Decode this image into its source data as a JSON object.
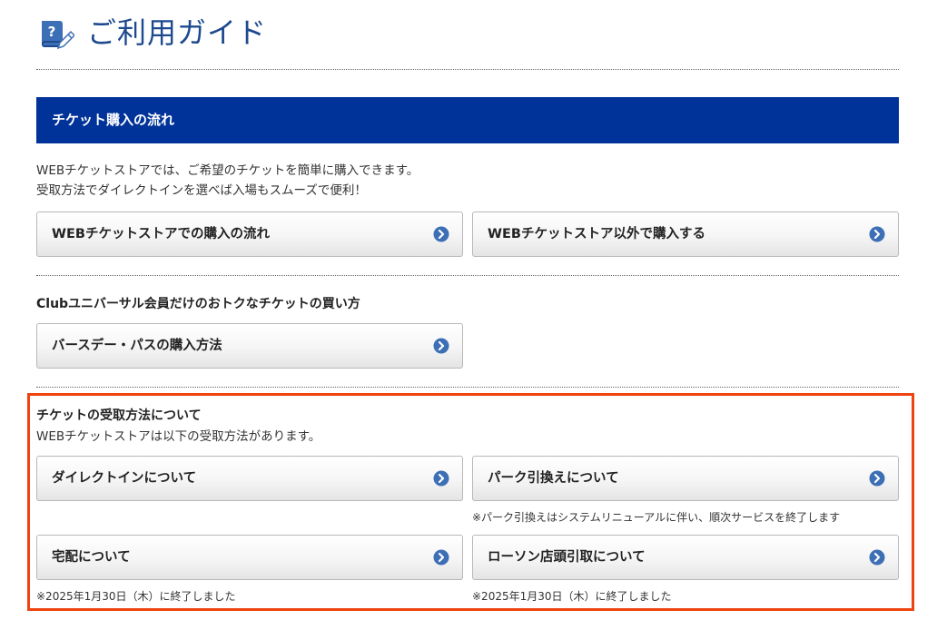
{
  "header": {
    "title": "ご利用ガイド",
    "icon": "guide-question-icon"
  },
  "purchase_flow": {
    "heading": "チケット購入の流れ",
    "description_line1": "WEBチケットストアでは、ご希望のチケットを簡単に購入できます。",
    "description_line2": "受取方法でダイレクトインを選べば入場もスムーズで便利！",
    "buttons": [
      {
        "label": "WEBチケットストアでの購入の流れ"
      },
      {
        "label": "WEBチケットストア以外で購入する"
      }
    ]
  },
  "club": {
    "heading": "Clubユニバーサル会員だけのおトクなチケットの買い方",
    "buttons": [
      {
        "label": "バースデー・パスの購入方法"
      }
    ]
  },
  "receive": {
    "heading": "チケットの受取方法について",
    "description": "WEBチケットストアは以下の受取方法があります。",
    "buttons": [
      {
        "label": "ダイレクトインについて",
        "note": ""
      },
      {
        "label": "パーク引換えについて",
        "note": "※パーク引換えはシステムリニューアルに伴い、順次サービスを終了します"
      },
      {
        "label": "宅配について",
        "note": "※2025年1月30日（木）に終了しました"
      },
      {
        "label": "ローソン店頭引取について",
        "note": "※2025年1月30日（木）に終了しました"
      }
    ]
  },
  "colors": {
    "title": "#1d4a8f",
    "section_bar": "#003399",
    "chevron": "#3d6fb6",
    "highlight": "#ee4411"
  }
}
